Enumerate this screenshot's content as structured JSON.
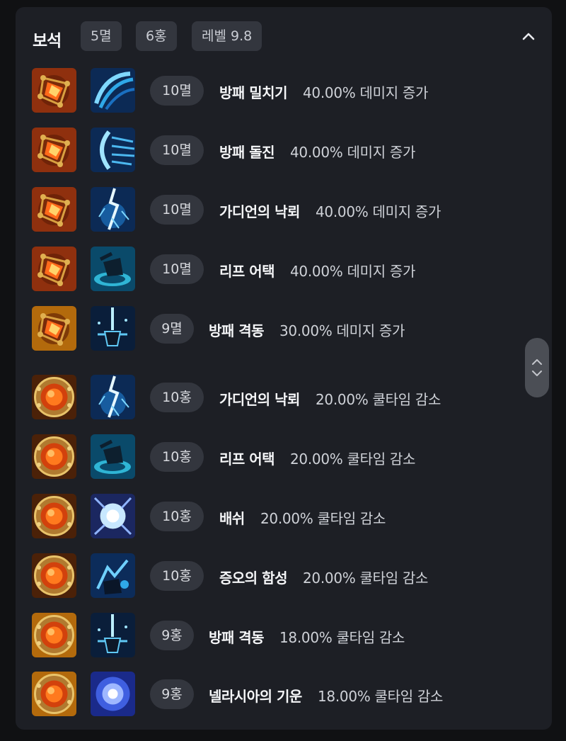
{
  "header": {
    "title": "보석",
    "chips": [
      "5멸",
      "6홍",
      "레벨 9.8"
    ]
  },
  "gems": [
    {
      "gem_type": "myeol",
      "level_badge": "10멸",
      "skill": "방패 밀치기",
      "effect": "40.00% 데미지 증가",
      "skill_icon": "shield-push-icon"
    },
    {
      "gem_type": "myeol",
      "level_badge": "10멸",
      "skill": "방패 돌진",
      "effect": "40.00% 데미지 증가",
      "skill_icon": "shield-charge-icon"
    },
    {
      "gem_type": "myeol",
      "level_badge": "10멸",
      "skill": "가디언의 낙뢰",
      "effect": "40.00% 데미지 증가",
      "skill_icon": "lightning-icon"
    },
    {
      "gem_type": "myeol",
      "level_badge": "10멸",
      "skill": "리프 어택",
      "effect": "40.00% 데미지 증가",
      "skill_icon": "leap-attack-icon"
    },
    {
      "gem_type": "myeol",
      "level_badge": "9멸",
      "skill": "방패 격동",
      "effect": "30.00% 데미지 증가",
      "skill_icon": "shield-burst-icon"
    },
    {
      "gem_type": "hong",
      "level_badge": "10홍",
      "skill": "가디언의 낙뢰",
      "effect": "20.00% 쿨타임 감소",
      "skill_icon": "lightning-icon"
    },
    {
      "gem_type": "hong",
      "level_badge": "10홍",
      "skill": "리프 어택",
      "effect": "20.00% 쿨타임 감소",
      "skill_icon": "leap-attack-icon"
    },
    {
      "gem_type": "hong",
      "level_badge": "10홍",
      "skill": "배쉬",
      "effect": "20.00% 쿨타임 감소",
      "skill_icon": "bash-icon"
    },
    {
      "gem_type": "hong",
      "level_badge": "10홍",
      "skill": "증오의 함성",
      "effect": "20.00% 쿨타임 감소",
      "skill_icon": "roar-icon"
    },
    {
      "gem_type": "hong",
      "level_badge": "9홍",
      "skill": "방패 격동",
      "effect": "18.00% 쿨타임 감소",
      "skill_icon": "shield-burst-icon"
    },
    {
      "gem_type": "hong",
      "level_badge": "9홍",
      "skill": "넬라시아의 기운",
      "effect": "18.00% 쿨타임 감소",
      "skill_icon": "nellasia-icon"
    }
  ],
  "colors": {
    "panel_bg": "#1d1f25",
    "chip_bg": "#33363e",
    "myeol_gem_bg": "#8a2b0c",
    "hong_gem_bg": "#4a1f0a",
    "grade9_bg": "#a8620a",
    "skill_blue": "#2fa8e8"
  }
}
